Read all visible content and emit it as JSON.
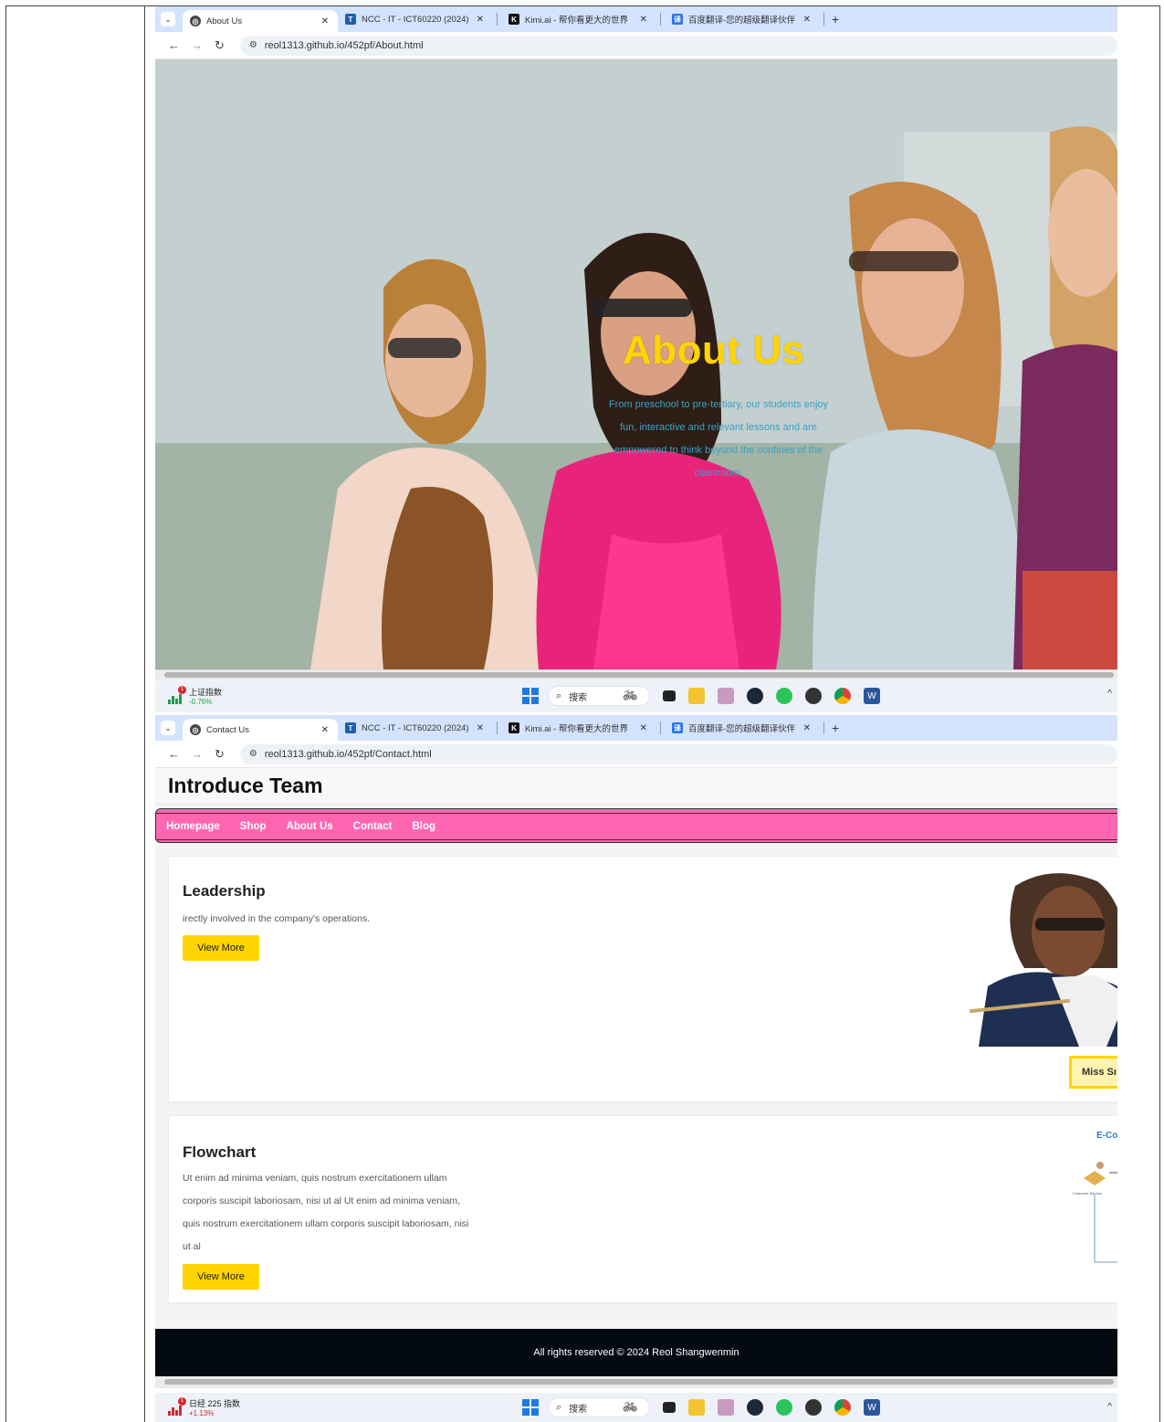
{
  "screenshot1": {
    "tabs": [
      {
        "title": "About Us",
        "favicon": "globe-icon",
        "active": true
      },
      {
        "title": "NCC - IT - ICT60220 (2024): I",
        "favicon": "t-icon",
        "active": false
      },
      {
        "title": "Kimi.ai - 帮你看更大的世界",
        "favicon": "k-icon",
        "active": false
      },
      {
        "title": "百度翻译-您的超级翻译伙伴",
        "favicon": "translate-icon",
        "active": false
      }
    ],
    "url": "reol1313.github.io/452pf/About.html",
    "hero": {
      "title": "About Us",
      "text": "From preschool to pre-tertiary, our students enjoy fun, interactive and relevant lessons and are empowered to think beyond the confines of the classroom."
    },
    "taskbar": {
      "widget_name": "上证指数",
      "widget_value": "-0.76%",
      "search_label": "搜索"
    }
  },
  "screenshot2": {
    "tabs": [
      {
        "title": "Contact Us",
        "favicon": "globe-icon",
        "active": true
      },
      {
        "title": "NCC - IT - ICT60220 (2024): I",
        "favicon": "t-icon",
        "active": false
      },
      {
        "title": "Kimi.ai - 帮你看更大的世界",
        "favicon": "k-icon",
        "active": false
      },
      {
        "title": "百度翻译-您的超级翻译伙伴",
        "favicon": "translate-icon",
        "active": false
      }
    ],
    "url": "reol1313.github.io/452pf/Contact.html",
    "site_title": "Introduce Team",
    "nav": [
      "Homepage",
      "Shop",
      "About Us",
      "Contact",
      "Blog"
    ],
    "leadership": {
      "heading": "Leadership",
      "text": "irectly involved in the company's operations.",
      "button": "View More",
      "badge": "Miss Sı"
    },
    "flowchart": {
      "heading": "Flowchart",
      "text": "Ut enim ad minima veniam, quis nostrum exercitationem ullam corporis suscipit laboriosam, nisi ut al Ut enim ad minima veniam, quis nostrum exercitationem ullam corporis suscipit laboriosam, nisi ut al",
      "button": "View More",
      "diagram_title": "E-Co",
      "diagram_label": "Customer Service"
    },
    "footer": "All rights reserved © 2024 Reol Shangwenmin",
    "taskbar": {
      "widget_name": "日经 225 指数",
      "widget_value": "+1.13%",
      "search_label": "搜索"
    }
  },
  "colors": {
    "nav_bg": "#ff66b2",
    "accent_yellow": "#ffd400",
    "hero_text": "#36a3c8",
    "footer_bg": "#040a12",
    "tabbar_bg": "#d3e3fd"
  }
}
